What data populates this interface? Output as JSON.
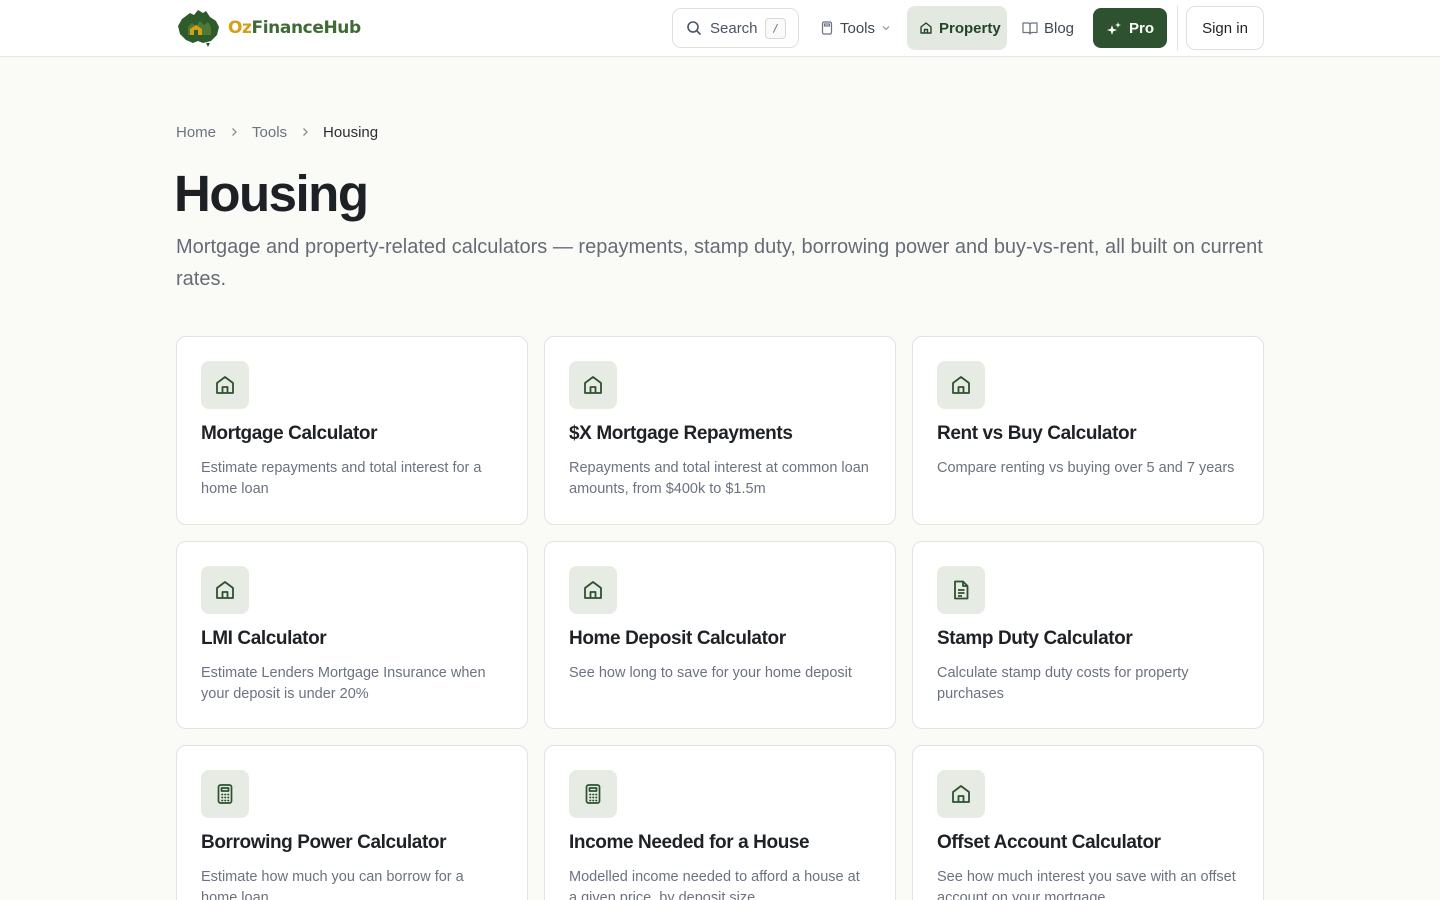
{
  "brand": {
    "oz": "Oz",
    "rest": "FinanceHub"
  },
  "search": {
    "label": "Search",
    "shortcut": "/"
  },
  "nav": {
    "tools": "Tools",
    "property": "Property",
    "blog": "Blog",
    "pro": "Pro",
    "signin": "Sign in"
  },
  "breadcrumb": {
    "home": "Home",
    "tools": "Tools",
    "current": "Housing"
  },
  "page": {
    "title": "Housing",
    "subtitle": "Mortgage and property-related calculators — repayments, stamp duty, borrowing power and buy-vs-rent, all built on current rates."
  },
  "colors": {
    "brand_green": "#2e5230",
    "accent_gold": "#d4a017",
    "icon_bg": "#e6ebe4"
  },
  "cards": [
    {
      "icon": "house-icon",
      "title": "Mortgage Calculator",
      "desc": "Estimate repayments and total interest for a home loan"
    },
    {
      "icon": "house-icon",
      "title": "$X Mortgage Repayments",
      "desc": "Repayments and total interest at common loan amounts, from $400k to $1.5m"
    },
    {
      "icon": "house-icon",
      "title": "Rent vs Buy Calculator",
      "desc": "Compare renting vs buying over 5 and 7 years"
    },
    {
      "icon": "house-icon",
      "title": "LMI Calculator",
      "desc": "Estimate Lenders Mortgage Insurance when your deposit is under 20%"
    },
    {
      "icon": "house-icon",
      "title": "Home Deposit Calculator",
      "desc": "See how long to save for your home deposit"
    },
    {
      "icon": "document-icon",
      "title": "Stamp Duty Calculator",
      "desc": "Calculate stamp duty costs for property purchases"
    },
    {
      "icon": "calculator-icon",
      "title": "Borrowing Power Calculator",
      "desc": "Estimate how much you can borrow for a home loan"
    },
    {
      "icon": "calculator-icon",
      "title": "Income Needed for a House",
      "desc": "Modelled income needed to afford a house at a given price, by deposit size"
    },
    {
      "icon": "house-icon",
      "title": "Offset Account Calculator",
      "desc": "See how much interest you save with an offset account on your mortgage"
    }
  ]
}
